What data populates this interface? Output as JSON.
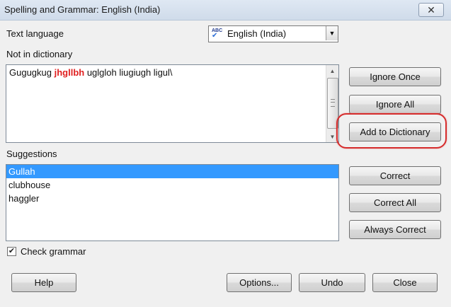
{
  "window": {
    "title": "Spelling and Grammar: English (India)",
    "close_glyph": "✕"
  },
  "text_language": {
    "label": "Text language",
    "value": "English (India)",
    "icon": "abc-spellcheck-icon",
    "icon_text": "ABC"
  },
  "not_in_dictionary": {
    "label": "Not in dictionary",
    "before": "Gugugkug ",
    "error_word": "jhgllbh",
    "after": " uglgloh liugiugh ligul\\"
  },
  "suggestions": {
    "label": "Suggestions",
    "items": [
      "Gullah",
      "clubhouse",
      "haggler"
    ],
    "selected": "Gullah"
  },
  "buttons": {
    "ignore_once": "Ignore Once",
    "ignore_all": "Ignore All",
    "add_to_dictionary": "Add to Dictionary",
    "correct": "Correct",
    "correct_all": "Correct All",
    "always_correct": "Always Correct",
    "help": "Help",
    "options": "Options...",
    "undo": "Undo",
    "close": "Close"
  },
  "check_grammar": {
    "label": "Check grammar",
    "checked": true
  },
  "colors": {
    "error_text": "#e02020",
    "selection": "#3399ff",
    "highlight_ring": "#d62c2c"
  }
}
